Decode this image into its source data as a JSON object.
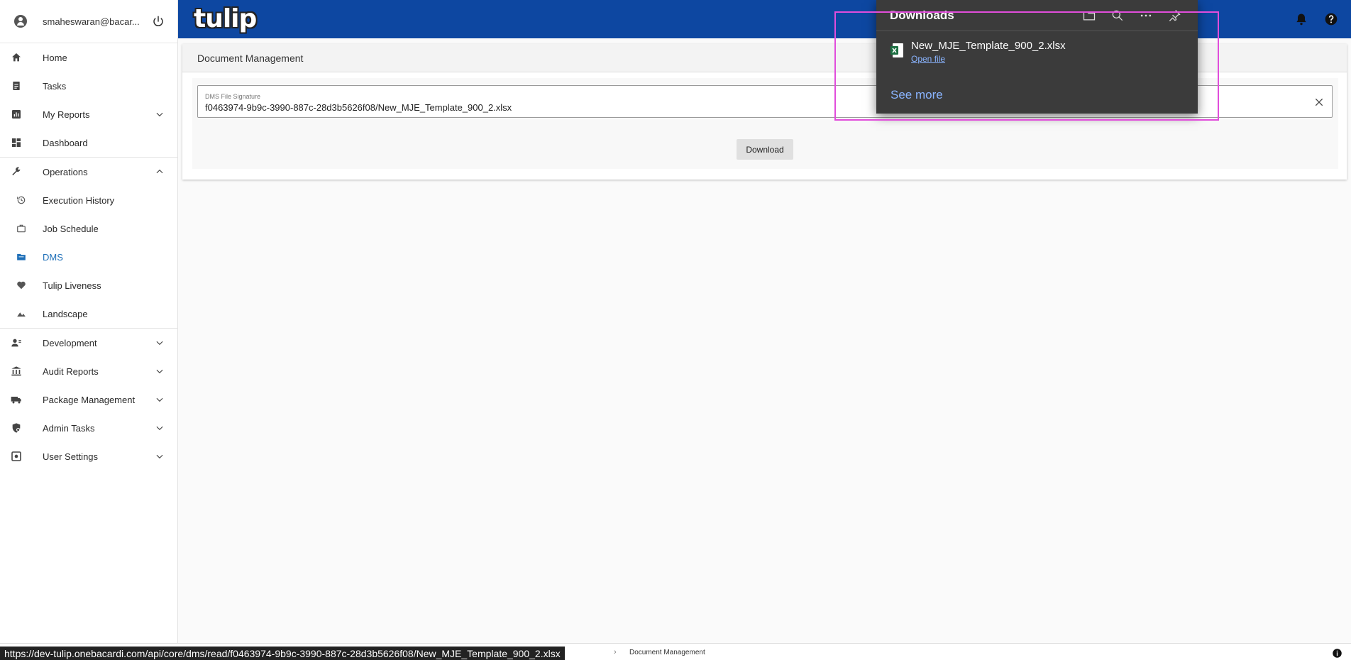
{
  "user": {
    "email": "smaheswaran@bacar..."
  },
  "sidebar": {
    "items": [
      {
        "label": "Home"
      },
      {
        "label": "Tasks"
      },
      {
        "label": "My Reports"
      },
      {
        "label": "Dashboard"
      },
      {
        "label": "Operations"
      },
      {
        "label": "Execution History"
      },
      {
        "label": "Job Schedule"
      },
      {
        "label": "DMS"
      },
      {
        "label": "Tulip Liveness"
      },
      {
        "label": "Landscape"
      },
      {
        "label": "Development"
      },
      {
        "label": "Audit Reports"
      },
      {
        "label": "Package Management"
      },
      {
        "label": "Admin Tasks"
      },
      {
        "label": "User Settings"
      }
    ]
  },
  "header": {
    "logo": "tulip"
  },
  "page": {
    "title": "Document Management",
    "field_label": "DMS File Signature",
    "field_value": "f0463974-9b9c-3990-887c-28d3b5626f08/New_MJE_Template_900_2.xlsx",
    "download_label": "Download"
  },
  "downloads": {
    "title": "Downloads",
    "file_name": "New_MJE_Template_900_2.xlsx",
    "open_label": "Open file",
    "see_more": "See more"
  },
  "status": {
    "url": "https://dev-tulip.onebacardi.com/api/core/dms/read/f0463974-9b9c-3990-887c-28d3b5626f08/New_MJE_Template_900_2.xlsx",
    "breadcrumb": "Document Management"
  },
  "colors": {
    "topbar": "#0d47a1",
    "active_nav": "#1e6fb8",
    "highlight": "#e14ddb",
    "flyout_bg": "#3b3b3b"
  }
}
